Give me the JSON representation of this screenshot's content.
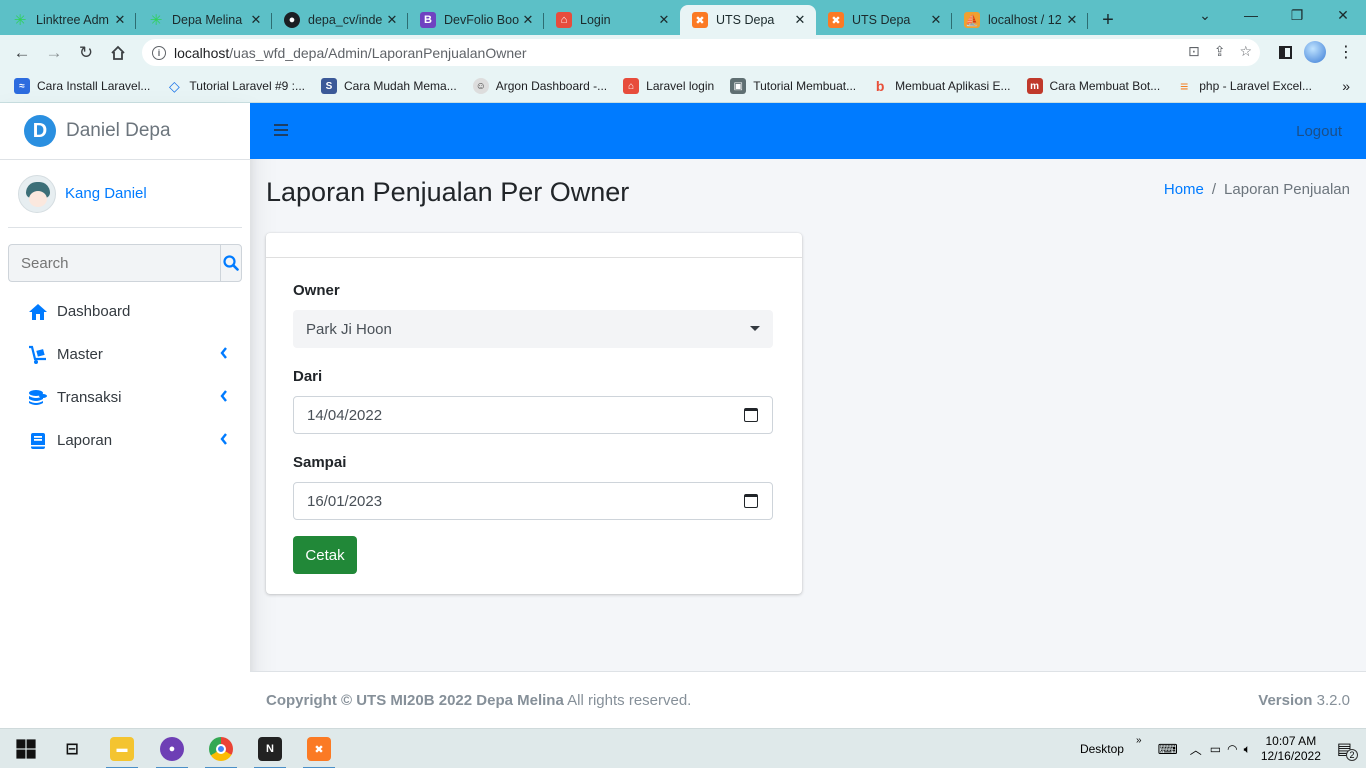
{
  "browser": {
    "tabs": [
      {
        "title": "Linktree Adm",
        "icon": "linktree-icon",
        "color": "#43e660"
      },
      {
        "title": "Depa Melina",
        "icon": "linktree-icon",
        "color": "#43e660"
      },
      {
        "title": "depa_cv/inde",
        "icon": "github-icon",
        "color": "#1b1f23"
      },
      {
        "title": "DevFolio Boo",
        "icon": "bootstrap-icon",
        "color": "#6f42c1"
      },
      {
        "title": "Login",
        "icon": "house-icon",
        "color": "#e74c3c"
      },
      {
        "title": "UTS Depa",
        "icon": "xampp-icon",
        "color": "#fb7a24"
      },
      {
        "title": "UTS Depa",
        "icon": "xampp-icon",
        "color": "#fb7a24"
      },
      {
        "title": "localhost / 12",
        "icon": "phpmyadmin-icon",
        "color": "#f0a030"
      }
    ],
    "active_tab": 5,
    "url_host": "localhost",
    "url_path": "/uas_wfd_depa/Admin/LaporanPenjualanOwner",
    "bookmarks": [
      {
        "label": "Cara Install Laravel...",
        "color": "#2d6cdf",
        "glyph": "≈"
      },
      {
        "label": "Tutorial Laravel #9 :...",
        "color": "#1a73e8",
        "glyph": "◇"
      },
      {
        "label": "Cara Mudah Mema...",
        "color": "#3b5998",
        "glyph": "S"
      },
      {
        "label": "Argon Dashboard -...",
        "color": "#555",
        "glyph": "☺"
      },
      {
        "label": "Laravel login",
        "color": "#e74c3c",
        "glyph": "⌂"
      },
      {
        "label": "Tutorial Membuat...",
        "color": "#5f6f72",
        "glyph": "▣"
      },
      {
        "label": "Membuat Aplikasi E...",
        "color": "#e8503a",
        "glyph": "b"
      },
      {
        "label": "Cara Membuat Bot...",
        "color": "#c0392b",
        "glyph": "m"
      },
      {
        "label": "php - Laravel Excel...",
        "color": "#f48024",
        "glyph": "≡"
      }
    ]
  },
  "app": {
    "brand": "Daniel Depa",
    "brand_letter": "D",
    "user": "Kang Daniel",
    "search_placeholder": "Search",
    "menu": [
      {
        "label": "Dashboard",
        "icon": "home-icon",
        "has_children": false
      },
      {
        "label": "Master",
        "icon": "dolly-icon",
        "has_children": true
      },
      {
        "label": "Transaksi",
        "icon": "coins-icon",
        "has_children": true
      },
      {
        "label": "Laporan",
        "icon": "book-icon",
        "has_children": true
      }
    ],
    "logout": "Logout",
    "page_title": "Laporan Penjualan Per Owner",
    "breadcrumb": {
      "home": "Home",
      "current": "Laporan Penjualan"
    },
    "form": {
      "owner_label": "Owner",
      "owner_value": "Park Ji Hoon",
      "dari_label": "Dari",
      "dari_value": "14/04/2022",
      "sampai_label": "Sampai",
      "sampai_value": "16/01/2023",
      "submit": "Cetak"
    },
    "footer": {
      "copyright_bold": "Copyright © UTS MI20B 2022 Depa Melina",
      "copyright_rest": " All rights reserved.",
      "version_label": "Version",
      "version_value": " 3.2.0"
    },
    "colors": {
      "primary": "#007bff",
      "success": "#218838",
      "text": "#343a40"
    }
  },
  "taskbar": {
    "desktop_label": "Desktop",
    "time": "10:07 AM",
    "date": "12/16/2022",
    "notifications": "2"
  }
}
